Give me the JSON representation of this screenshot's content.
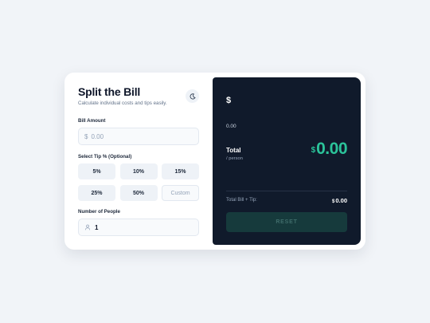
{
  "header": {
    "title": "Split the Bill",
    "subtitle": "Calculate individual costs and tips easily.",
    "theme_icon": "moon-icon"
  },
  "bill": {
    "label": "Bill Amount",
    "prefix": "$",
    "placeholder": "0.00",
    "value": ""
  },
  "tip": {
    "label": "Select Tip % (Optional)",
    "options": [
      "5%",
      "10%",
      "15%",
      "25%",
      "50%"
    ],
    "custom_placeholder": "Custom"
  },
  "people": {
    "label": "Number of People",
    "icon": "person-icon",
    "value": "1"
  },
  "summary": {
    "currency_symbol": "$",
    "bill_display": "0.00",
    "total_label": "Total",
    "per_person_label": "/ person",
    "total_currency": "$",
    "total_value": "0.00",
    "total_bill_tip_label": "Total Bill + Tip:",
    "total_bill_tip_currency": "$",
    "total_bill_tip_value": "0.00",
    "reset_label": "RESET"
  },
  "colors": {
    "panel_bg": "#101a2b",
    "accent": "#2bc39a",
    "reset_bg": "#163a3c",
    "page_bg": "#f1f4f8"
  }
}
